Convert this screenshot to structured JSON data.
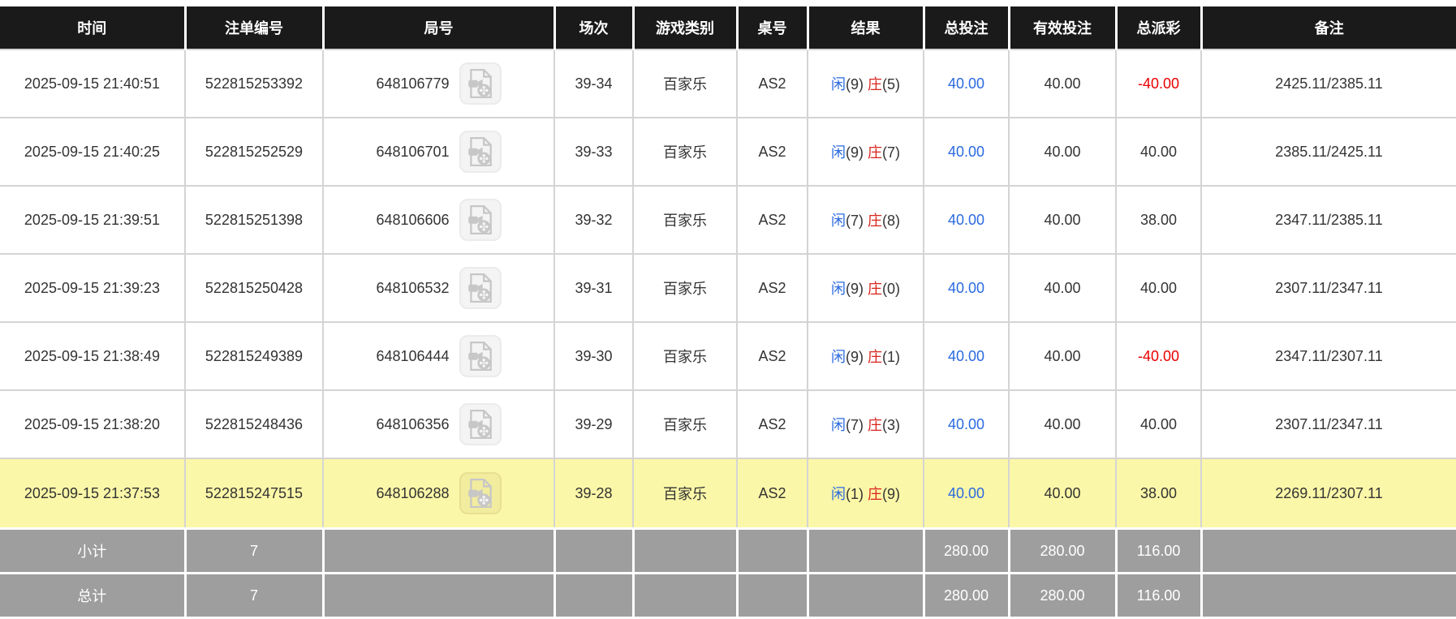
{
  "colors": {
    "header_bg": "#1a1a1a",
    "bet_blue": "#2a6ae0",
    "banker_red": "#d9251d",
    "negative_red": "#ea0000",
    "highlight_yellow": "#fbf7a8",
    "summary_gray": "#9e9e9e"
  },
  "table": {
    "columns": [
      {
        "key": "time",
        "label": "时间"
      },
      {
        "key": "bet_id",
        "label": "注单编号"
      },
      {
        "key": "round_no",
        "label": "局号"
      },
      {
        "key": "session",
        "label": "场次"
      },
      {
        "key": "game_type",
        "label": "游戏类别"
      },
      {
        "key": "table_no",
        "label": "桌号"
      },
      {
        "key": "result",
        "label": "结果"
      },
      {
        "key": "total_bet",
        "label": "总投注"
      },
      {
        "key": "valid_bet",
        "label": "有效投注"
      },
      {
        "key": "total_payout",
        "label": "总派彩"
      },
      {
        "key": "remark",
        "label": "备注"
      }
    ],
    "video_icon_name": "video-replay",
    "rows": [
      {
        "time": "2025-09-15 21:40:51",
        "bet_id": "522815253392",
        "round_no": "648106779",
        "session": "39-34",
        "game_type": "百家乐",
        "table_no": "AS2",
        "result": {
          "player_label": "闲",
          "player_num": "(9)",
          "banker_label": "庄",
          "banker_num": "(5)"
        },
        "total_bet": "40.00",
        "valid_bet": "40.00",
        "total_payout": "-40.00",
        "remark": "2425.11/2385.11",
        "highlighted": false
      },
      {
        "time": "2025-09-15 21:40:25",
        "bet_id": "522815252529",
        "round_no": "648106701",
        "session": "39-33",
        "game_type": "百家乐",
        "table_no": "AS2",
        "result": {
          "player_label": "闲",
          "player_num": "(9)",
          "banker_label": "庄",
          "banker_num": "(7)"
        },
        "total_bet": "40.00",
        "valid_bet": "40.00",
        "total_payout": "40.00",
        "remark": "2385.11/2425.11",
        "highlighted": false
      },
      {
        "time": "2025-09-15 21:39:51",
        "bet_id": "522815251398",
        "round_no": "648106606",
        "session": "39-32",
        "game_type": "百家乐",
        "table_no": "AS2",
        "result": {
          "player_label": "闲",
          "player_num": "(7)",
          "banker_label": "庄",
          "banker_num": "(8)"
        },
        "total_bet": "40.00",
        "valid_bet": "40.00",
        "total_payout": "38.00",
        "remark": "2347.11/2385.11",
        "highlighted": false
      },
      {
        "time": "2025-09-15 21:39:23",
        "bet_id": "522815250428",
        "round_no": "648106532",
        "session": "39-31",
        "game_type": "百家乐",
        "table_no": "AS2",
        "result": {
          "player_label": "闲",
          "player_num": "(9)",
          "banker_label": "庄",
          "banker_num": "(0)"
        },
        "total_bet": "40.00",
        "valid_bet": "40.00",
        "total_payout": "40.00",
        "remark": "2307.11/2347.11",
        "highlighted": false
      },
      {
        "time": "2025-09-15 21:38:49",
        "bet_id": "522815249389",
        "round_no": "648106444",
        "session": "39-30",
        "game_type": "百家乐",
        "table_no": "AS2",
        "result": {
          "player_label": "闲",
          "player_num": "(9)",
          "banker_label": "庄",
          "banker_num": "(1)"
        },
        "total_bet": "40.00",
        "valid_bet": "40.00",
        "total_payout": "-40.00",
        "remark": "2347.11/2307.11",
        "highlighted": false
      },
      {
        "time": "2025-09-15 21:38:20",
        "bet_id": "522815248436",
        "round_no": "648106356",
        "session": "39-29",
        "game_type": "百家乐",
        "table_no": "AS2",
        "result": {
          "player_label": "闲",
          "player_num": "(7)",
          "banker_label": "庄",
          "banker_num": "(3)"
        },
        "total_bet": "40.00",
        "valid_bet": "40.00",
        "total_payout": "40.00",
        "remark": "2307.11/2347.11",
        "highlighted": false
      },
      {
        "time": "2025-09-15 21:37:53",
        "bet_id": "522815247515",
        "round_no": "648106288",
        "session": "39-28",
        "game_type": "百家乐",
        "table_no": "AS2",
        "result": {
          "player_label": "闲",
          "player_num": "(1)",
          "banker_label": "庄",
          "banker_num": "(9)"
        },
        "total_bet": "40.00",
        "valid_bet": "40.00",
        "total_payout": "38.00",
        "remark": "2269.11/2307.11",
        "highlighted": true
      }
    ],
    "summary": [
      {
        "label": "小计",
        "count": "7",
        "total_bet": "280.00",
        "valid_bet": "280.00",
        "total_payout": "116.00"
      },
      {
        "label": "总计",
        "count": "7",
        "total_bet": "280.00",
        "valid_bet": "280.00",
        "total_payout": "116.00"
      }
    ]
  }
}
